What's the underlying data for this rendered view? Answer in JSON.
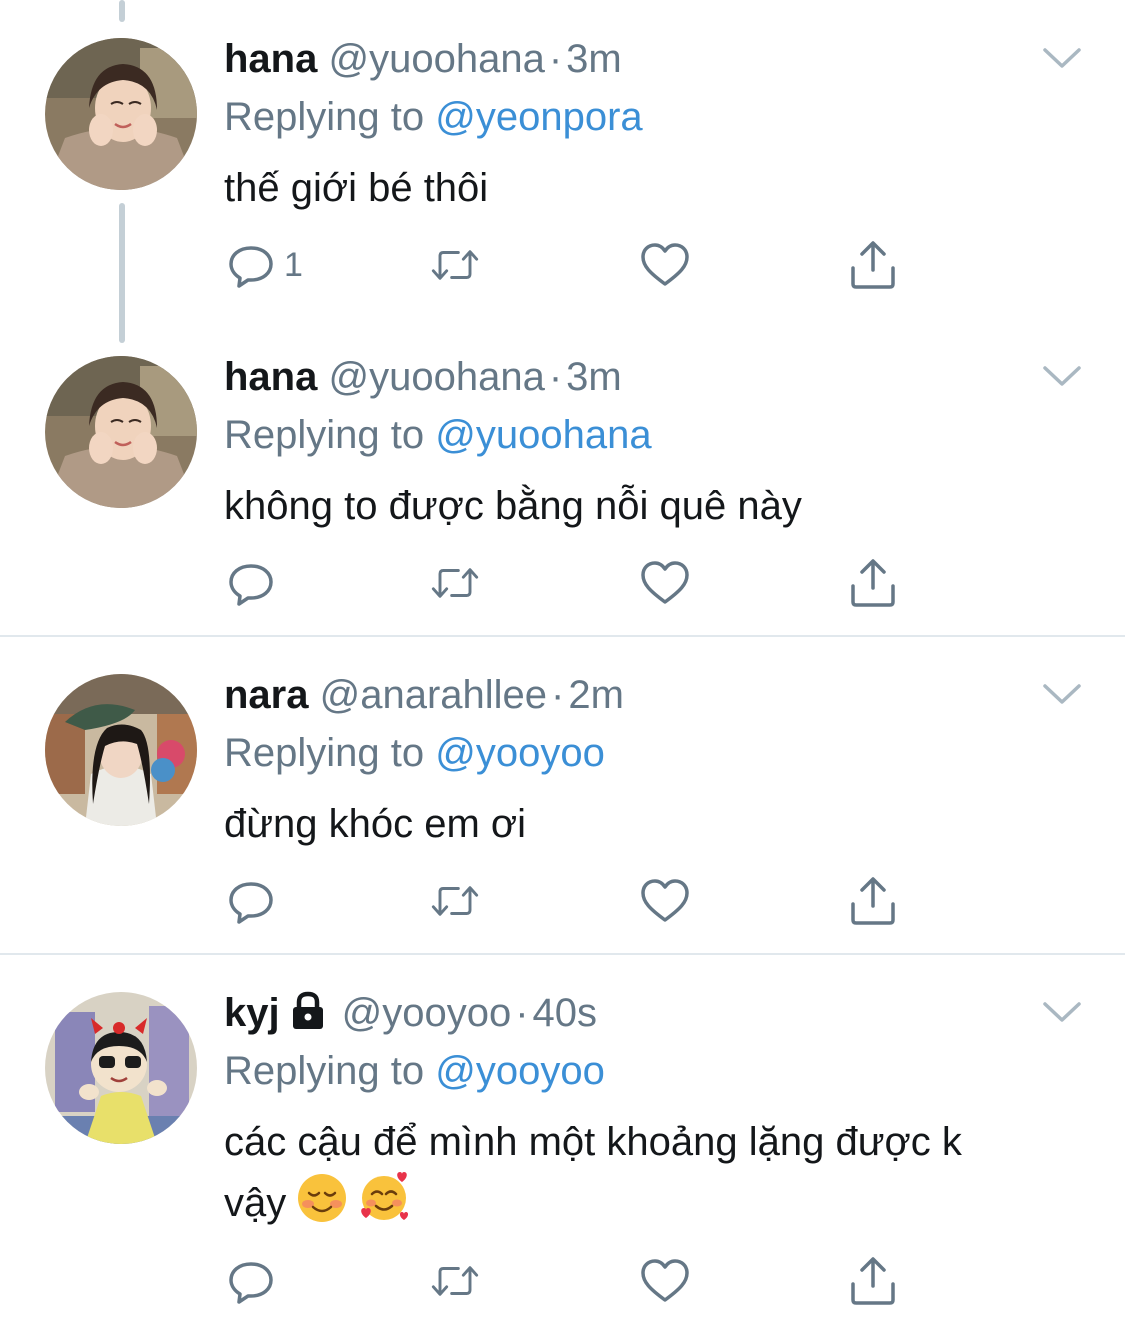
{
  "colors": {
    "name": "#14171a",
    "meta": "#657786",
    "mention": "#3b8fd6",
    "divider": "#e1e8ed",
    "thread_line": "#c4cfd6"
  },
  "tweets": [
    {
      "name": "hana",
      "handle": "@yuoohana",
      "dot": "·",
      "time": "3m",
      "reply_prefix": "Replying to",
      "reply_to": "@yeonpora",
      "text_line1": "thế giới bé thôi",
      "reply_count": "1",
      "avatar_icon": "hana-avatar"
    },
    {
      "name": "hana",
      "handle": "@yuoohana",
      "dot": "·",
      "time": "3m",
      "reply_prefix": "Replying to",
      "reply_to": "@yuoohana",
      "text_line1": "không to được bằng nỗi quê này",
      "reply_count": "",
      "avatar_icon": "hana-avatar"
    },
    {
      "name": "nara",
      "handle": "@anarahllee",
      "dot": "·",
      "time": "2m",
      "reply_prefix": "Replying to",
      "reply_to": "@yooyoo",
      "text_line1": "đừng khóc em ơi",
      "reply_count": "",
      "avatar_icon": "nara-avatar"
    },
    {
      "name": "kyj",
      "handle": "@yooyoo",
      "dot": "·",
      "time": "40s",
      "reply_prefix": "Replying to",
      "reply_to": "@yooyoo",
      "text_line1": "các cậu để mình một khoảng lặng được k",
      "text_line2": "vậy",
      "reply_count": "",
      "avatar_icon": "cartoon-avatar",
      "emojis": [
        "smiling-face-emoji",
        "smiling-face-with-hearts-emoji"
      ]
    }
  ]
}
